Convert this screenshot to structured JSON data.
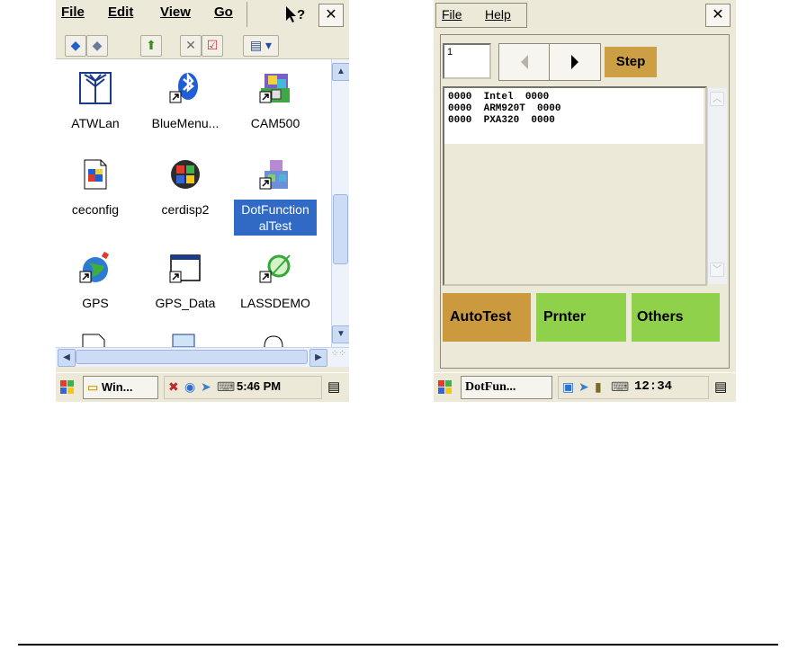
{
  "left_screen": {
    "menu": {
      "file": "File",
      "edit": "Edit",
      "view": "View",
      "go": "Go"
    },
    "icons": [
      {
        "label": "ATWLan",
        "icon": "antenna-icon"
      },
      {
        "label": "BlueMenu...",
        "icon": "bluetooth-icon"
      },
      {
        "label": "CAM500",
        "icon": "camera-app-icon"
      },
      {
        "label": "ceconfig",
        "icon": "config-file-icon"
      },
      {
        "label": "cerdisp2",
        "icon": "windows-logo-icon"
      },
      {
        "label": "DotFunctionalTest",
        "label_line1": "DotFunction",
        "label_line2": "alTest",
        "icon": "setup-icon",
        "selected": true
      },
      {
        "label": "GPS",
        "icon": "globe-icon"
      },
      {
        "label": "GPS_Data",
        "icon": "window-shortcut-icon"
      },
      {
        "label": "LASSDEMO",
        "icon": "laser-icon"
      }
    ],
    "taskbar": {
      "task": "Win...",
      "clock": "5:46 PM"
    },
    "colors": {
      "selection": "#316ac5",
      "scroll": "#cddcf5"
    }
  },
  "right_screen": {
    "menu": {
      "file": "File",
      "help": "Help"
    },
    "step_value": "1",
    "step_button": "Step",
    "log_lines": [
      "0000  Intel  0000",
      "0000  ARM920T  0000",
      "0000  PXA320  0000"
    ],
    "buttons": {
      "autotest": "AutoTest",
      "printer": "Prnter",
      "others": "Others"
    },
    "taskbar": {
      "task": "DotFun...",
      "clock": "12:34"
    },
    "colors": {
      "step": "#cc9f44",
      "autotest": "#cc9a3e",
      "green": "#8fd14a"
    }
  }
}
